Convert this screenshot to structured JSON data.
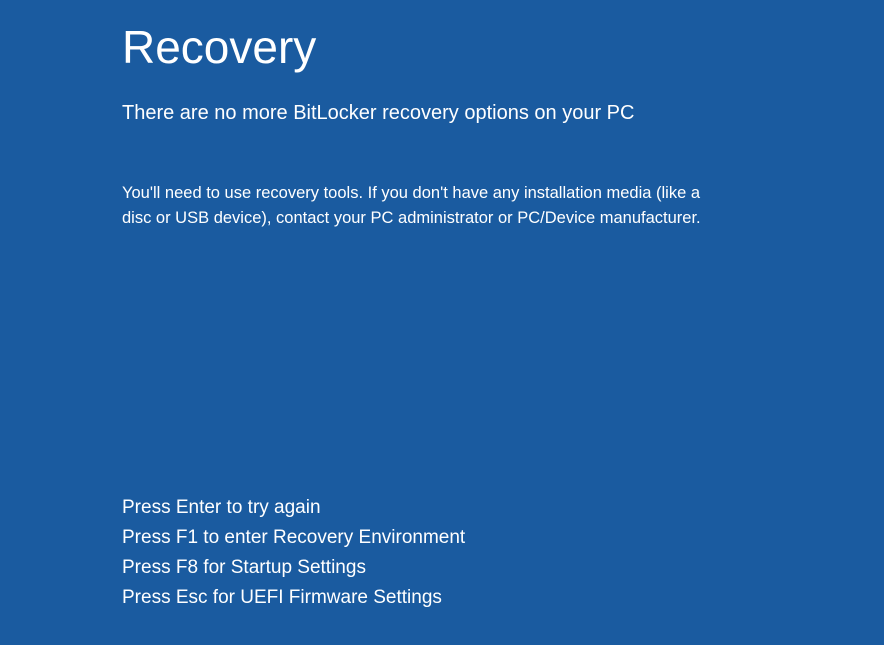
{
  "title": "Recovery",
  "subtitle": "There are no more BitLocker recovery options on your PC",
  "body": "You'll need to use recovery tools. If you don't have any installation media (like a disc or USB device), contact your PC administrator or PC/Device manufacturer.",
  "instructions": [
    "Press Enter to try again",
    "Press F1 to enter Recovery Environment",
    "Press F8 for Startup Settings",
    "Press Esc for UEFI Firmware Settings"
  ]
}
